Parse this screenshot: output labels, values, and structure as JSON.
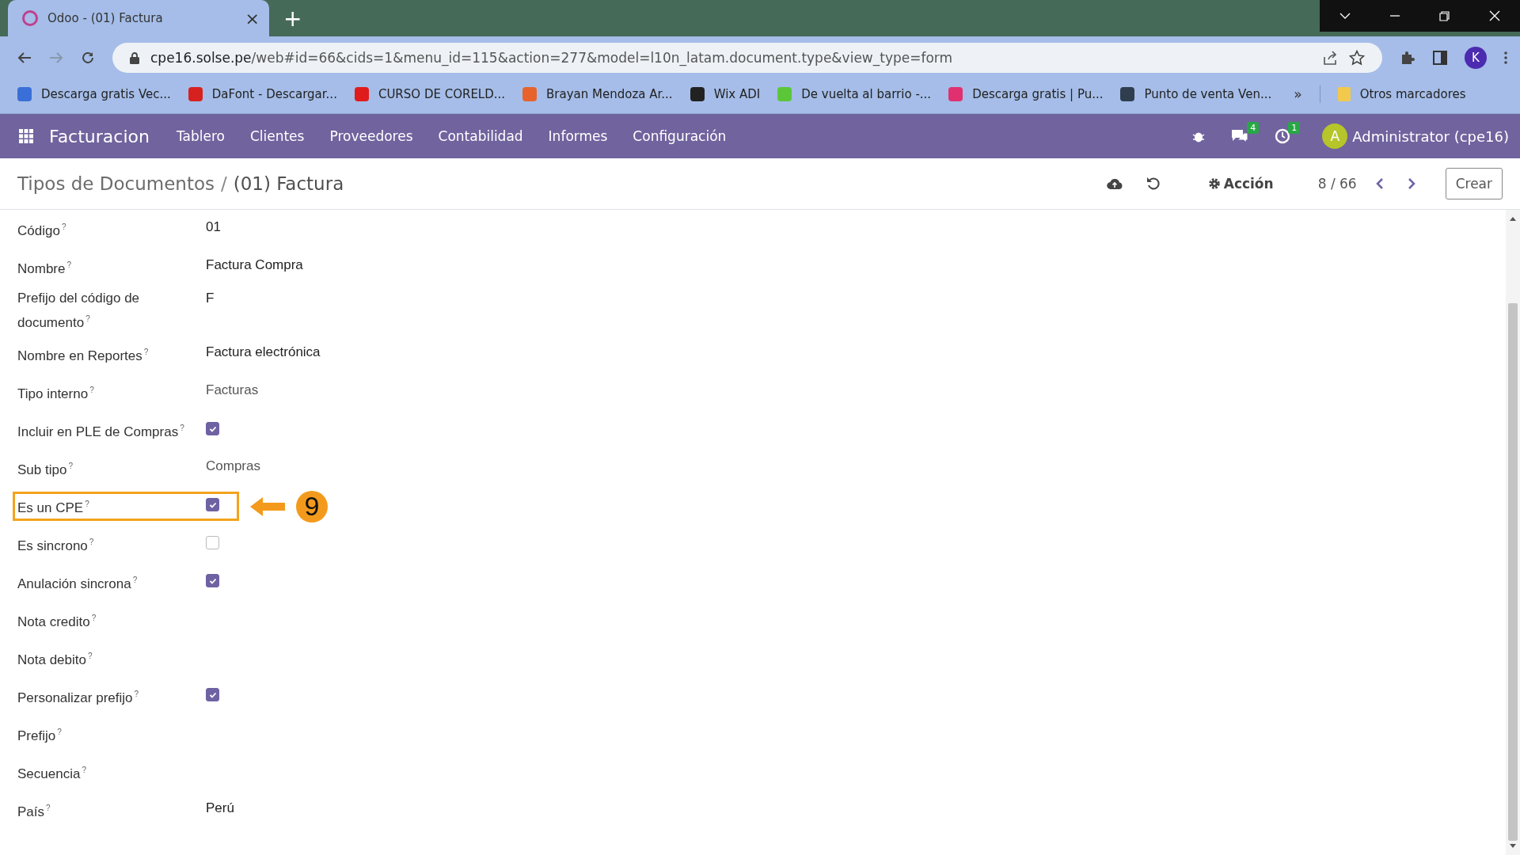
{
  "browser": {
    "tab": {
      "title": "Odoo - (01) Factura",
      "close": "×"
    },
    "new_tab": "+",
    "url": {
      "host": "cpe16.solse.pe",
      "path": "/web#id=66&cids=1&menu_id=115&action=277&model=l10n_latam.document.type&view_type=form"
    },
    "profile": "K",
    "bookmarks": [
      {
        "label": "Descarga gratis Vec...",
        "color": "#3b6fd8"
      },
      {
        "label": "DaFont - Descargar...",
        "color": "#d6211f"
      },
      {
        "label": "CURSO DE CORELD...",
        "color": "#e01b1b"
      },
      {
        "label": "Brayan Mendoza Ar...",
        "color": "#e8622c"
      },
      {
        "label": "Wix ADI",
        "color": "#222222"
      },
      {
        "label": "De vuelta al barrio -...",
        "color": "#5cc639"
      },
      {
        "label": "Descarga gratis | Pu...",
        "color": "#e0306f"
      },
      {
        "label": "Punto de venta Ven...",
        "color": "#2f3e4f"
      }
    ],
    "more": "»",
    "other_bookmarks": "Otros marcadores"
  },
  "app": {
    "name": "Facturacion",
    "menu": [
      "Tablero",
      "Clientes",
      "Proveedores",
      "Contabilidad",
      "Informes",
      "Configuración"
    ],
    "messages_count": "4",
    "activities_count": "1",
    "user_initial": "A",
    "user": "Administrator (cpe16)"
  },
  "control_panel": {
    "breadcrumb": [
      {
        "label": "Tipos de Documentos",
        "kind": "link"
      },
      {
        "label": "/",
        "kind": "separator"
      },
      {
        "label": "(01) Factura",
        "kind": "current"
      }
    ],
    "action": "Acción",
    "pager": "8 / 66",
    "create": "Crear"
  },
  "fields": [
    {
      "label": "Código",
      "help": "?",
      "kind": "text",
      "value": "01",
      "highlighted": false
    },
    {
      "label": "Nombre",
      "help": "?",
      "kind": "text",
      "value": "Factura Compra",
      "highlighted": false
    },
    {
      "label": "Prefijo del código de documento",
      "help": "?",
      "kind": "text",
      "value": "F",
      "highlighted": false
    },
    {
      "label": "Nombre en Reportes",
      "help": "?",
      "kind": "text",
      "value": "Factura electrónica",
      "highlighted": false
    },
    {
      "label": "Tipo interno",
      "help": "?",
      "kind": "select",
      "value": "Facturas",
      "highlighted": false
    },
    {
      "label": "Incluir en PLE de Compras",
      "help": "?",
      "kind": "checkbox",
      "checked": true,
      "highlighted": false
    },
    {
      "label": "Sub tipo",
      "help": "?",
      "kind": "select",
      "value": "Compras",
      "highlighted": false
    },
    {
      "label": "Es un CPE",
      "help": "?",
      "kind": "checkbox",
      "checked": true,
      "highlighted": true,
      "callout": "9"
    },
    {
      "label": "Es sincrono",
      "help": "?",
      "kind": "checkbox",
      "checked": false,
      "highlighted": false
    },
    {
      "label": "Anulación sincrona",
      "help": "?",
      "kind": "checkbox",
      "checked": true,
      "highlighted": false
    },
    {
      "label": "Nota credito",
      "help": "?",
      "kind": "empty",
      "highlighted": false
    },
    {
      "label": "Nota debito",
      "help": "?",
      "kind": "empty",
      "highlighted": false
    },
    {
      "label": "Personalizar prefijo",
      "help": "?",
      "kind": "checkbox",
      "checked": true,
      "highlighted": false
    },
    {
      "label": "Prefijo",
      "help": "?",
      "kind": "empty",
      "highlighted": false
    },
    {
      "label": "Secuencia",
      "help": "?",
      "kind": "empty",
      "highlighted": false
    },
    {
      "label": "País",
      "help": "?",
      "kind": "text",
      "value": "Perú",
      "highlighted": false
    }
  ]
}
